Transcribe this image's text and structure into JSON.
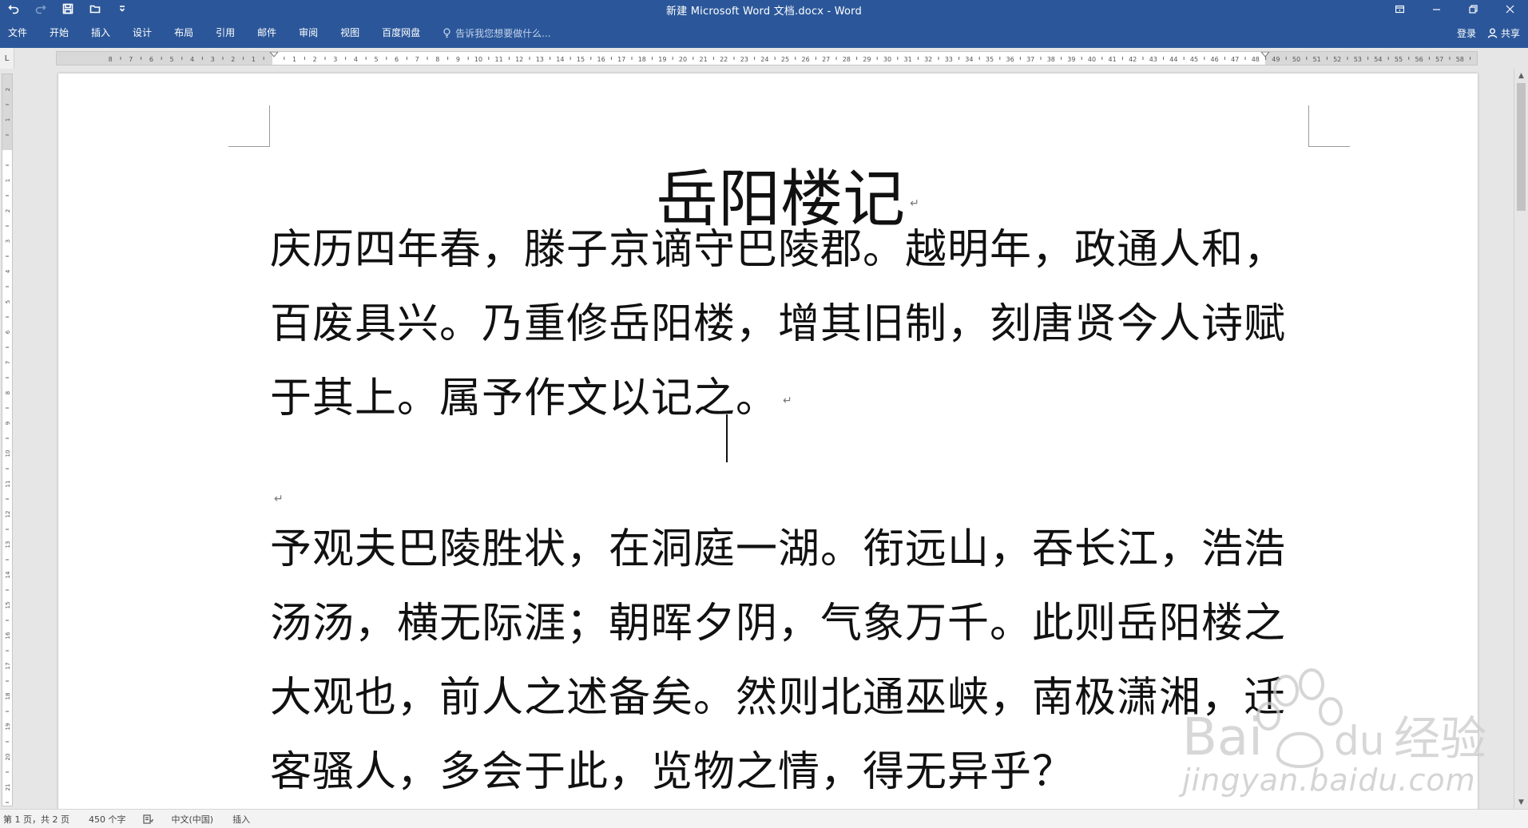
{
  "window": {
    "title": "新建 Microsoft Word 文档.docx - Word"
  },
  "quick_access": {
    "undo_icon": "undo-icon",
    "redo_icon": "redo-icon",
    "save_icon": "save-icon",
    "open_icon": "open-folder-icon",
    "customize_icon": "customize-dropdown-icon"
  },
  "ribbon": {
    "tabs": [
      {
        "label": "文件"
      },
      {
        "label": "开始"
      },
      {
        "label": "插入"
      },
      {
        "label": "设计"
      },
      {
        "label": "布局"
      },
      {
        "label": "引用"
      },
      {
        "label": "邮件"
      },
      {
        "label": "审阅"
      },
      {
        "label": "视图"
      },
      {
        "label": "百度网盘"
      }
    ],
    "tell_me_placeholder": "告诉我您想要做什么...",
    "signin_label": "登录",
    "share_label": "共享"
  },
  "ruler": {
    "corner_label": "L"
  },
  "document": {
    "heading": "岳阳楼记",
    "paragraph1": "庆历四年春，滕子京谪守巴陵郡。越明年，政通人和，百废具兴。乃重修岳阳楼，增其旧制，刻唐贤今人诗赋于其上。属予作文以记之。",
    "paragraph2": "予观夫巴陵胜状，在洞庭一湖。衔远山，吞长江，浩浩汤汤，横无际涯；朝晖夕阴，气象万千。此则岳阳楼之大观也，前人之述备矣。然则北通巫峡，南极潇湘，迁客骚人，多会于此，览物之情，得无异乎？",
    "paragraph_mark": "↵"
  },
  "status_bar": {
    "page_info": "第 1 页，共 2 页",
    "word_count": "450 个字",
    "language": "中文(中国)",
    "mode": "插入"
  },
  "watermark": {
    "text": "jingyan.baidu.com",
    "brand": "Bai du 经验"
  },
  "colors": {
    "ribbon_blue": "#2b579a",
    "canvas_gray": "#e6e6e6",
    "page_white": "#ffffff"
  }
}
